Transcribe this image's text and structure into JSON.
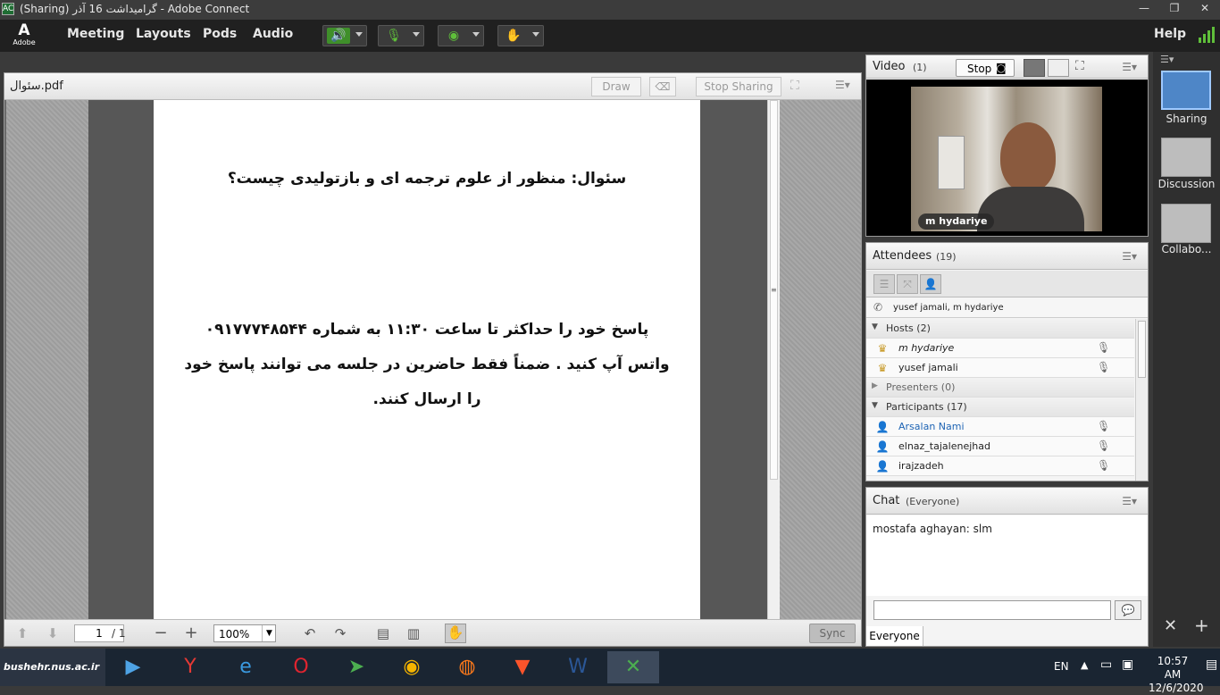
{
  "window": {
    "title": "(Sharing) گرامیداشت 16 آذر - Adobe Connect",
    "app_icon": "adobe-connect-icon",
    "min": "—",
    "max": "❐",
    "close": "✕"
  },
  "menubar": {
    "logo": "Adobe",
    "items": [
      "Meeting",
      "Layouts",
      "Pods",
      "Audio"
    ],
    "help": "Help"
  },
  "share": {
    "filename": "سئوال.pdf",
    "draw": "Draw",
    "stop_sharing": "Stop Sharing",
    "question": "سئوال: منظور از علوم ترجمه ای و بازتولیدی چیست؟",
    "body_lines": [
      "پاسخ خود را حداکثر تا ساعت ۱۱:۳۰ به شماره ۰۹۱۷۷۷۴۸۵۴۴",
      "واتس آپ کنید . ضمناً فقط حاضرین در جلسه می توانند پاسخ خود",
      "را ارسال کنند."
    ],
    "page_input": "1",
    "page_total": "/ 1",
    "zoom": "100%",
    "sync": "Sync"
  },
  "video": {
    "title": "Video",
    "count": "(1)",
    "stop": "Stop",
    "presenter": "m hydariye"
  },
  "attendees": {
    "title": "Attendees",
    "count": "(19)",
    "speaking": "yusef jamali, m hydariye",
    "hosts_label": "Hosts (2)",
    "hosts": [
      "m hydariye",
      "yusef jamali"
    ],
    "presenters_label": "Presenters (0)",
    "participants_label": "Participants (17)",
    "participants": [
      "Arsalan  Nami",
      "elnaz_tajalenejhad",
      "irajzadeh"
    ]
  },
  "chat": {
    "title": "Chat",
    "scope": "(Everyone)",
    "messages": [
      {
        "sender": "mostafa aghayan:",
        "text": "slm"
      }
    ],
    "input_value": "",
    "tab": "Everyone"
  },
  "layouts": [
    "Sharing",
    "Discussion",
    "Collabo..."
  ],
  "taskbar": {
    "watermark": "bushehr.nus.ac.ir",
    "lang": "EN",
    "time": "10:57 AM",
    "date": "12/6/2020"
  },
  "colors": {
    "accent_green": "#5fbf3a",
    "participant_blue": "#1e64b4",
    "layout_selected": "#4e86c7"
  }
}
